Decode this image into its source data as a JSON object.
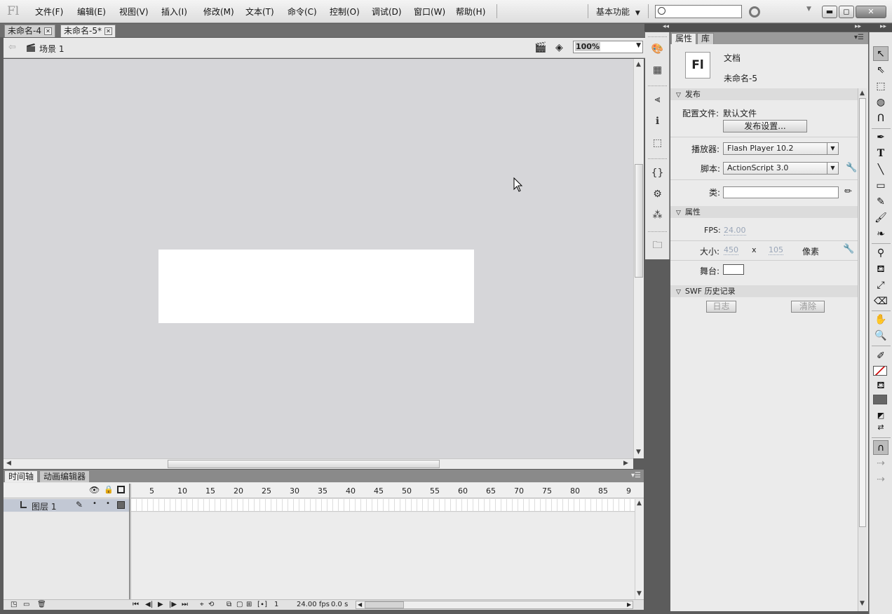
{
  "menubar": {
    "logo": "Fl",
    "items": [
      "文件(F)",
      "编辑(E)",
      "视图(V)",
      "插入(I)",
      "修改(M)",
      "文本(T)",
      "命令(C)",
      "控制(O)",
      "调试(D)",
      "窗口(W)",
      "帮助(H)"
    ],
    "workspace": "基本功能",
    "search_placeholder": ""
  },
  "document_tabs": [
    {
      "label": "未命名-4",
      "active": false
    },
    {
      "label": "未命名-5*",
      "active": true
    }
  ],
  "editbar": {
    "scene": "场景 1",
    "zoom": "100%"
  },
  "stage": {
    "width": 450,
    "height": 105,
    "color": "#ffffff"
  },
  "timeline": {
    "tabs": [
      "时间轴",
      "动画编辑器"
    ],
    "frame_numbers": [
      "5",
      "10",
      "15",
      "20",
      "25",
      "30",
      "35",
      "40",
      "45",
      "50",
      "55",
      "60",
      "65",
      "70",
      "75",
      "80",
      "85",
      "9"
    ],
    "layer_name": "图层 1",
    "status": {
      "current_frame": "1",
      "fps": "24.00",
      "fps_unit": "fps",
      "time": "0.0 s"
    }
  },
  "properties": {
    "tabs": [
      "属性",
      "库"
    ],
    "doc_icon": "Fl",
    "doc_type": "文档",
    "doc_name": "未命名-5",
    "publish": {
      "header": "发布",
      "profile_label": "配置文件:",
      "profile_value": "默认文件",
      "settings_button": "发布设置...",
      "player_label": "播放器:",
      "player_value": "Flash Player 10.2",
      "script_label": "脚本:",
      "script_value": "ActionScript 3.0",
      "class_label": "类:"
    },
    "props": {
      "header": "属性",
      "fps_label": "FPS:",
      "fps_value": "24.00",
      "size_label": "大小:",
      "width": "450",
      "x": "x",
      "height": "105",
      "unit": "像素",
      "stage_label": "舞台:"
    },
    "swf_history": {
      "header": "SWF 历史记录",
      "log_button": "日志",
      "clear_button": "清除"
    }
  },
  "colors": {
    "stage_bg": "#d6d6d9",
    "stroke_color": "#ffffff",
    "fill_color": "#666666"
  }
}
